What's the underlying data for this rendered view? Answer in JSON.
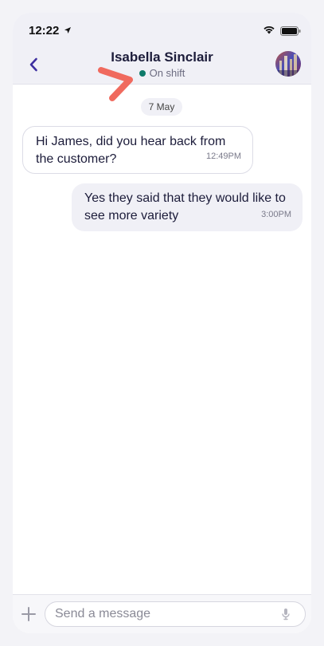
{
  "status_bar": {
    "time": "12:22"
  },
  "header": {
    "contact_name": "Isabella Sinclair",
    "status_text": "On shift",
    "status_color": "#0e7a6a",
    "back_icon": "chevron-left-icon",
    "avatar": "contact-avatar"
  },
  "conversation": {
    "date_divider": "7 May",
    "messages": [
      {
        "direction": "incoming",
        "text": "Hi James, did you hear back from the customer?",
        "time": "12:49PM"
      },
      {
        "direction": "outgoing",
        "text": "Yes they said that they would like to see more variety",
        "time": "3:00PM"
      }
    ]
  },
  "composer": {
    "placeholder": "Send a message",
    "value": "",
    "add_icon": "plus-icon",
    "mic_icon": "microphone-icon"
  },
  "colors": {
    "accent": "#3d2fa0",
    "annotation": "#f06a5e",
    "header_bg": "#f0f0f6"
  }
}
